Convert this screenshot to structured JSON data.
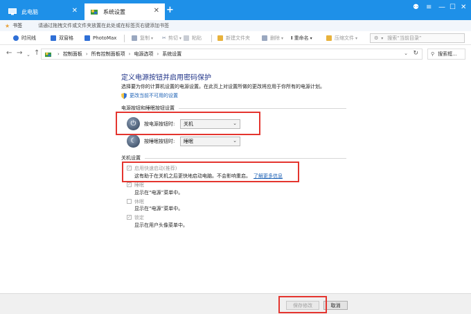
{
  "tabs": [
    {
      "label": "此电脑",
      "active": false
    },
    {
      "label": "系统设置",
      "active": true
    }
  ],
  "window_controls": {
    "skin": "⚉",
    "menu": "≡",
    "minimize": "—",
    "maximize": "☐",
    "close": "✕",
    "new_tab": "+"
  },
  "bookmarks": {
    "label": "书签",
    "hint": "请通过拖拽文件或文件夹放置在此处或在标签页右键添加书签"
  },
  "toolbar": {
    "items": [
      {
        "label": "时间线",
        "color": "#2f6fd6"
      },
      {
        "label": "双窗格",
        "color": "#2f6fd6"
      },
      {
        "label": "PhotoMax",
        "color": "#2f6fd6"
      },
      {
        "label": "复制",
        "color": "#9aa8c0"
      },
      {
        "label": "剪切",
        "color": "#9aa8c0"
      },
      {
        "label": "粘贴",
        "color": "#9aa8c0"
      },
      {
        "label": "新建文件夹",
        "color": "#e8b23c"
      },
      {
        "label": "删除",
        "color": "#9aa8c0"
      },
      {
        "label": "重命名",
        "color": "#444444"
      },
      {
        "label": "压缩文件",
        "color": "#e8b23c"
      }
    ],
    "search_placeholder": "搜索“当前目录”"
  },
  "address": {
    "crumbs": [
      "控制面板",
      "所有控制面板项",
      "电源选项",
      "系统设置"
    ],
    "search_placeholder": "搜索框..."
  },
  "content": {
    "title": "定义电源按钮并启用密码保护",
    "desc": "选择要为你的计算机设置的电源设置。在此页上对设置所做的更改将应用于你所有的电源计划。",
    "change_link": "更改当前不可用的设置",
    "section1": "电源按钮和睡眠按钮设置",
    "power_button_label": "按电源按钮时:",
    "power_button_value": "关机",
    "sleep_button_label": "按睡眠按钮时:",
    "sleep_button_value": "睡眠",
    "section2": "关机设置",
    "options": [
      {
        "label": "启用快速启动(推荐)",
        "checked": true,
        "desc": "这有助于在关机之后更快地启动电脑。不会影响重启。",
        "link": "了解更多信息"
      },
      {
        "label": "睡眠",
        "checked": true,
        "desc": "显示在“电源”菜单中。",
        "link": ""
      },
      {
        "label": "休眠",
        "checked": false,
        "desc": "显示在“电源”菜单中。",
        "link": ""
      },
      {
        "label": "锁定",
        "checked": true,
        "desc": "显示在用户头像菜单中。",
        "link": ""
      }
    ]
  },
  "footer": {
    "save": "保存修改",
    "cancel": "取消"
  },
  "colors": {
    "tab_bar": "#1e90e8",
    "title": "#1e3287",
    "link": "#1a5fb4",
    "highlight": "#e4342e"
  }
}
